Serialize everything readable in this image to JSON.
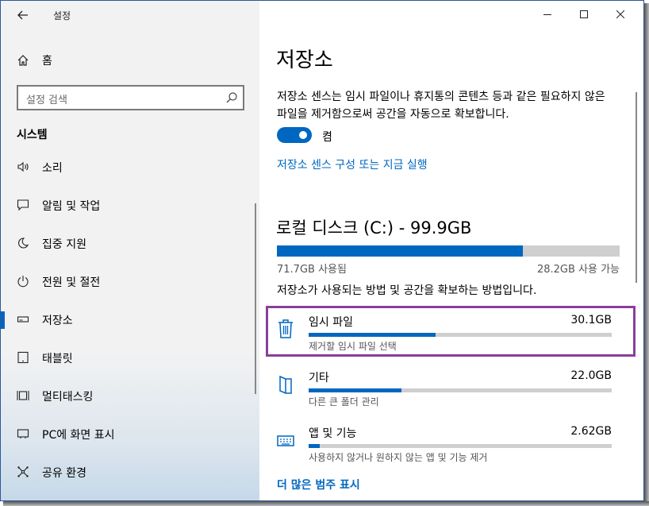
{
  "window": {
    "title": "설정",
    "accent": "#0067c0",
    "highlight": "#8a3f9a"
  },
  "sidebar": {
    "home_label": "홈",
    "search_placeholder": "설정 검색",
    "section_title": "시스템",
    "items": [
      {
        "label": "소리",
        "icon": "speaker-icon"
      },
      {
        "label": "알림 및 작업",
        "icon": "notification-icon"
      },
      {
        "label": "집중 지원",
        "icon": "moon-icon"
      },
      {
        "label": "전원 및 절전",
        "icon": "power-icon"
      },
      {
        "label": "저장소",
        "icon": "storage-icon",
        "active": true
      },
      {
        "label": "태블릿",
        "icon": "tablet-icon"
      },
      {
        "label": "멀티태스킹",
        "icon": "multitasking-icon"
      },
      {
        "label": "PC에 화면 표시",
        "icon": "project-icon"
      },
      {
        "label": "공유 환경",
        "icon": "share-icon"
      }
    ]
  },
  "main": {
    "title": "저장소",
    "description": "저장소 센스는 임시 파일이나 휴지통의 콘텐츠 등과 같은 필요하지 않은 파일을 제거함으로써 공간을 자동으로 확보합니다.",
    "toggle": {
      "state_label": "켬",
      "on": true
    },
    "config_link": "저장소 센스 구성 또는 지금 실행",
    "disk": {
      "title": "로컬 디스크 (C:) - 99.9GB",
      "used_label": "71.7GB 사용됨",
      "free_label": "28.2GB 사용 가능",
      "used_fraction": 0.718
    },
    "note": "저장소가 사용되는 방법 및 공간을 확보하는 방법입니다.",
    "categories": [
      {
        "name": "임시 파일",
        "size": "30.1GB",
        "sub": "제거할 임시 파일 선택",
        "fraction": 0.42,
        "icon": "trash-icon"
      },
      {
        "name": "기타",
        "size": "22.0GB",
        "sub": "다른 큰 폴더 관리",
        "fraction": 0.307,
        "icon": "folder-icon"
      },
      {
        "name": "앱 및 기능",
        "size": "2.62GB",
        "sub": "사용하지 않거나 원하지 않는 앱 및 기능 제거",
        "fraction": 0.037,
        "icon": "keyboard-icon"
      }
    ],
    "more_link": "더 많은 범주 표시"
  }
}
